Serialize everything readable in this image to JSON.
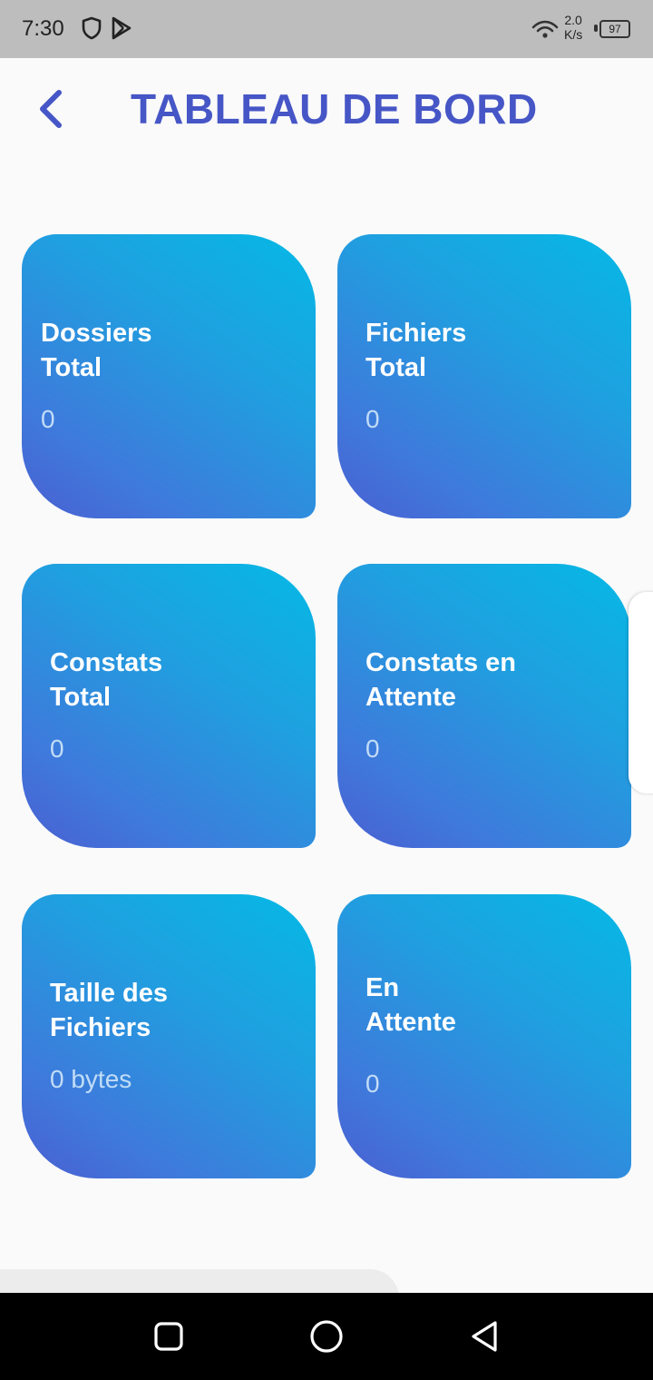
{
  "status_bar": {
    "time": "7:30",
    "net_speed_value": "2.0",
    "net_speed_unit": "K/s",
    "battery": "97"
  },
  "header": {
    "title": "TABLEAU DE BORD"
  },
  "cards": [
    {
      "label_line1": "Dossiers",
      "label_line2": "Total",
      "value": "0"
    },
    {
      "label_line1": "Fichiers",
      "label_line2": "Total",
      "value": "0"
    },
    {
      "label_line1": "Constats",
      "label_line2": "Total",
      "value": "0"
    },
    {
      "label_line1": "Constats en",
      "label_line2": "Attente",
      "value": "0"
    },
    {
      "label_line1": "Taille des",
      "label_line2": "Fichiers",
      "value": "0 bytes"
    },
    {
      "label_line1": "En",
      "label_line2": "Attente",
      "value": "0"
    }
  ],
  "colors": {
    "title": "#4656c6",
    "card_gradient_start": "#05b9e5",
    "card_gradient_end": "#4a5fd2",
    "background": "#fafafa"
  }
}
